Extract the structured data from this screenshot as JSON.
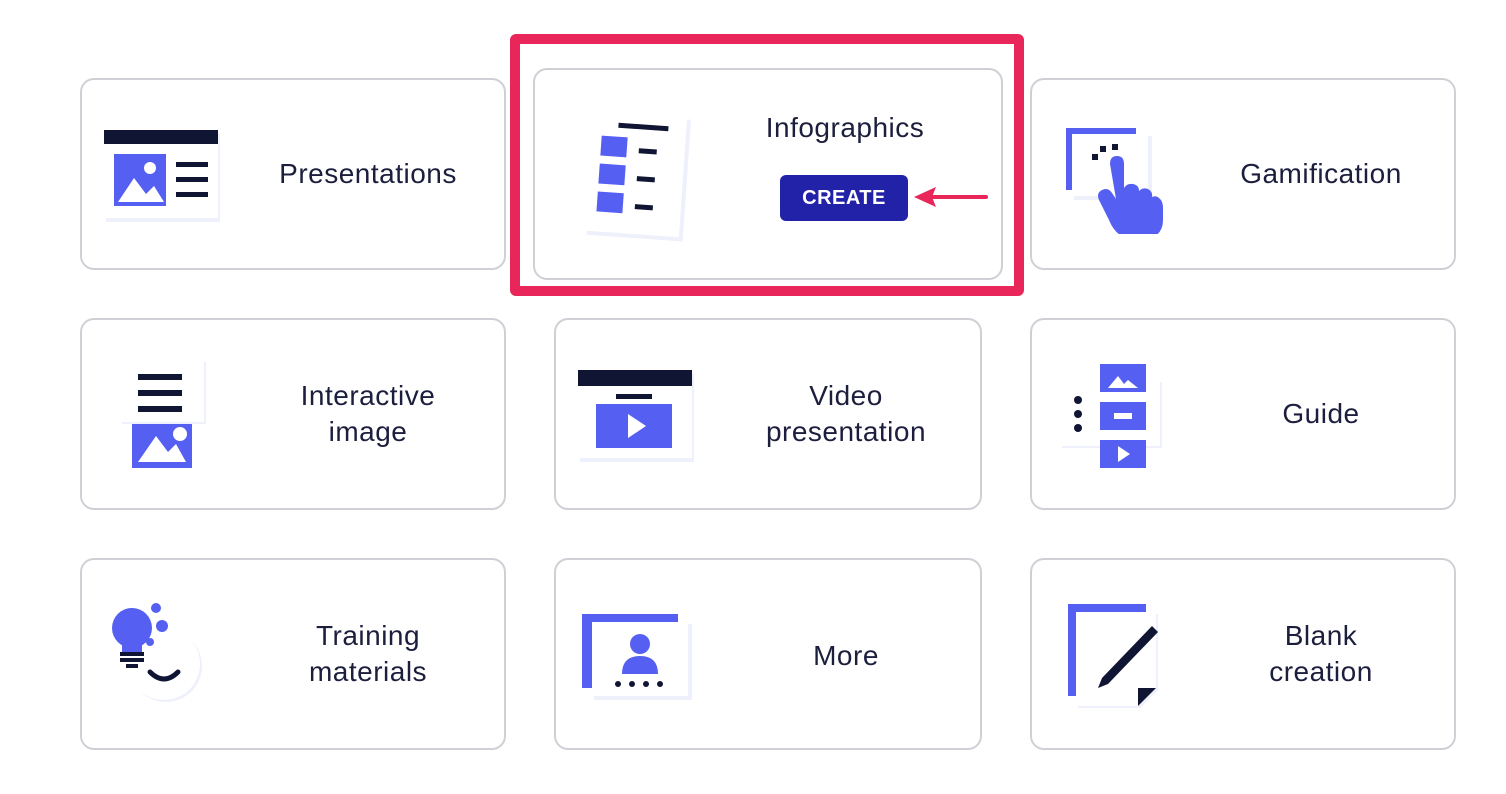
{
  "cards": {
    "presentations": {
      "label": "Presentations"
    },
    "infographics": {
      "label": "Infographics",
      "button": "CREATE"
    },
    "gamification": {
      "label": "Gamification"
    },
    "interactive_image": {
      "label1": "Interactive",
      "label2": "image"
    },
    "video_presentation": {
      "label1": "Video",
      "label2": "presentation"
    },
    "guide": {
      "label": "Guide"
    },
    "training_materials": {
      "label1": "Training",
      "label2": "materials"
    },
    "more": {
      "label": "More"
    },
    "blank_creation": {
      "label1": "Blank",
      "label2": "creation"
    }
  },
  "colors": {
    "accent": "#5560f2",
    "dark": "#0f1533",
    "highlight": "#e8265a",
    "button": "#2222a8"
  }
}
